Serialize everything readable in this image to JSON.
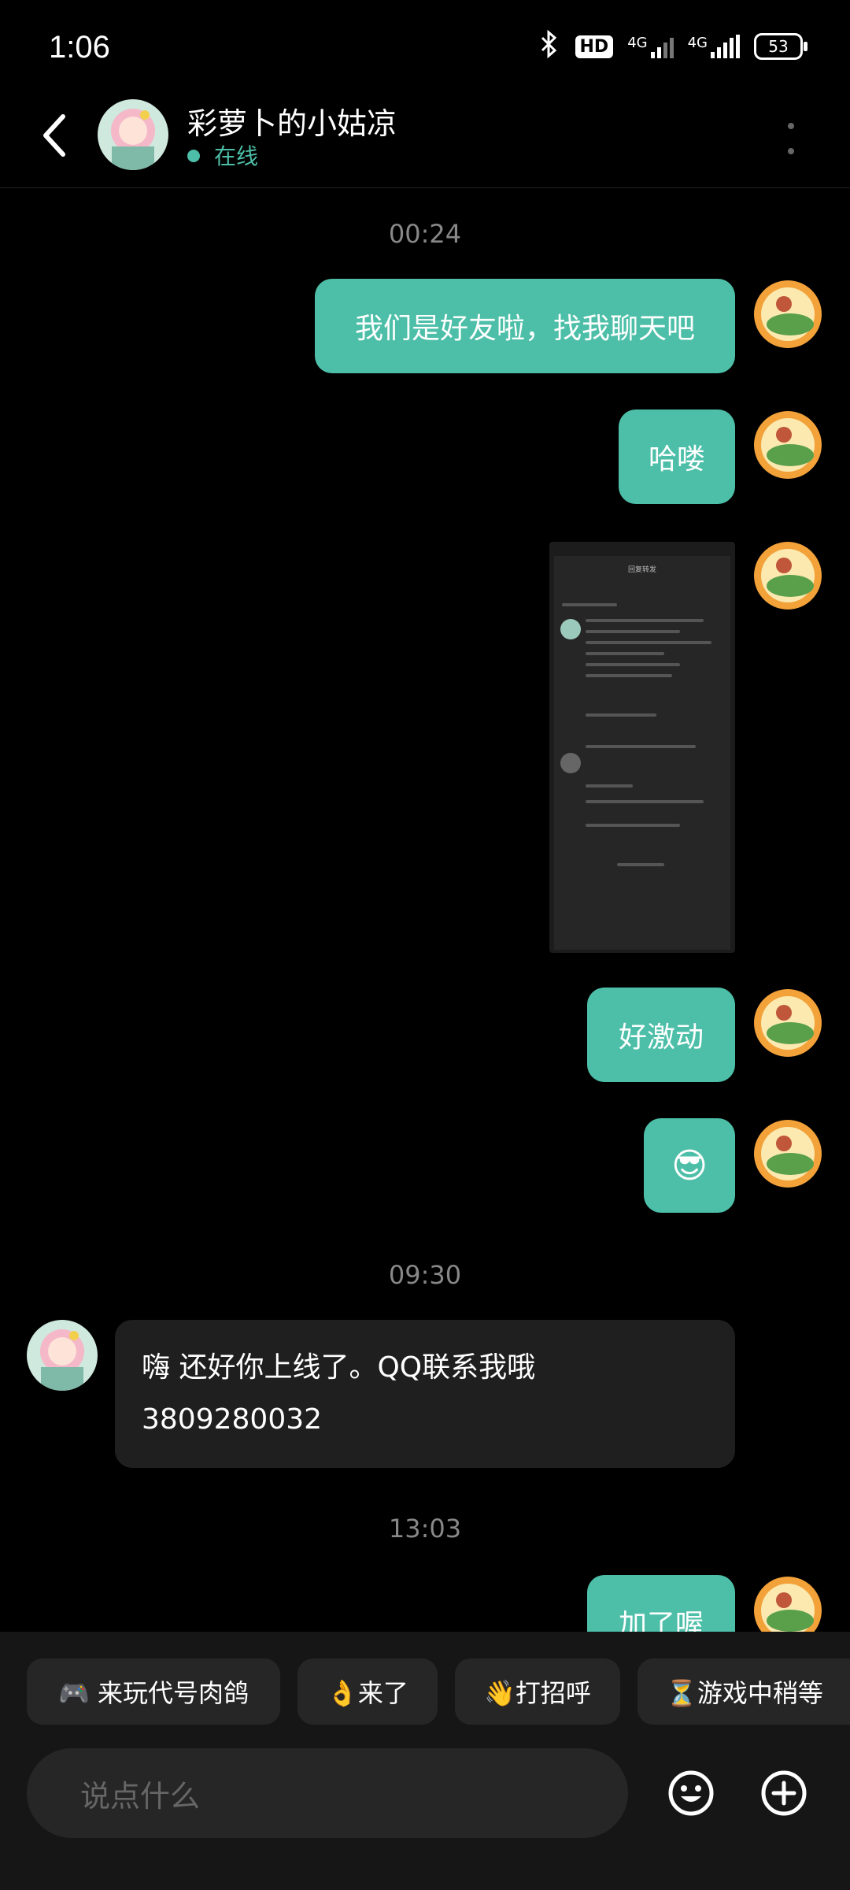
{
  "status_bar": {
    "time": "1:06",
    "hd": "HD",
    "net1": "4G",
    "net2": "4G",
    "battery": "53"
  },
  "header": {
    "name": "彩萝卜的小姑凉",
    "status": "在线"
  },
  "messages": {
    "ts1": "00:24",
    "m1": "我们是好友啦，找我聊天吧",
    "m2": "哈喽",
    "m3_caption_top": "回复转发",
    "m4": "好激动",
    "m5_emoji": "😎",
    "ts2": "09:30",
    "in1_line1": "嗨  还好你上线了。QQ联系我哦",
    "in1_line2": "3809280032",
    "ts3": "13:03",
    "m6": "加了喔"
  },
  "quick_replies": [
    "🎮 来玩代号肉鸽",
    "👌来了",
    "👋打招呼",
    "⏳游戏中稍等"
  ],
  "composer": {
    "placeholder": "说点什么"
  },
  "colors": {
    "accent": "#4dbfa8",
    "bg": "#000000",
    "panel": "#161616"
  },
  "icons": [
    "back-arrow-icon",
    "more-vert-icon",
    "bluetooth-icon",
    "signal-icon",
    "battery-icon",
    "emoji-icon",
    "plus-icon"
  ]
}
